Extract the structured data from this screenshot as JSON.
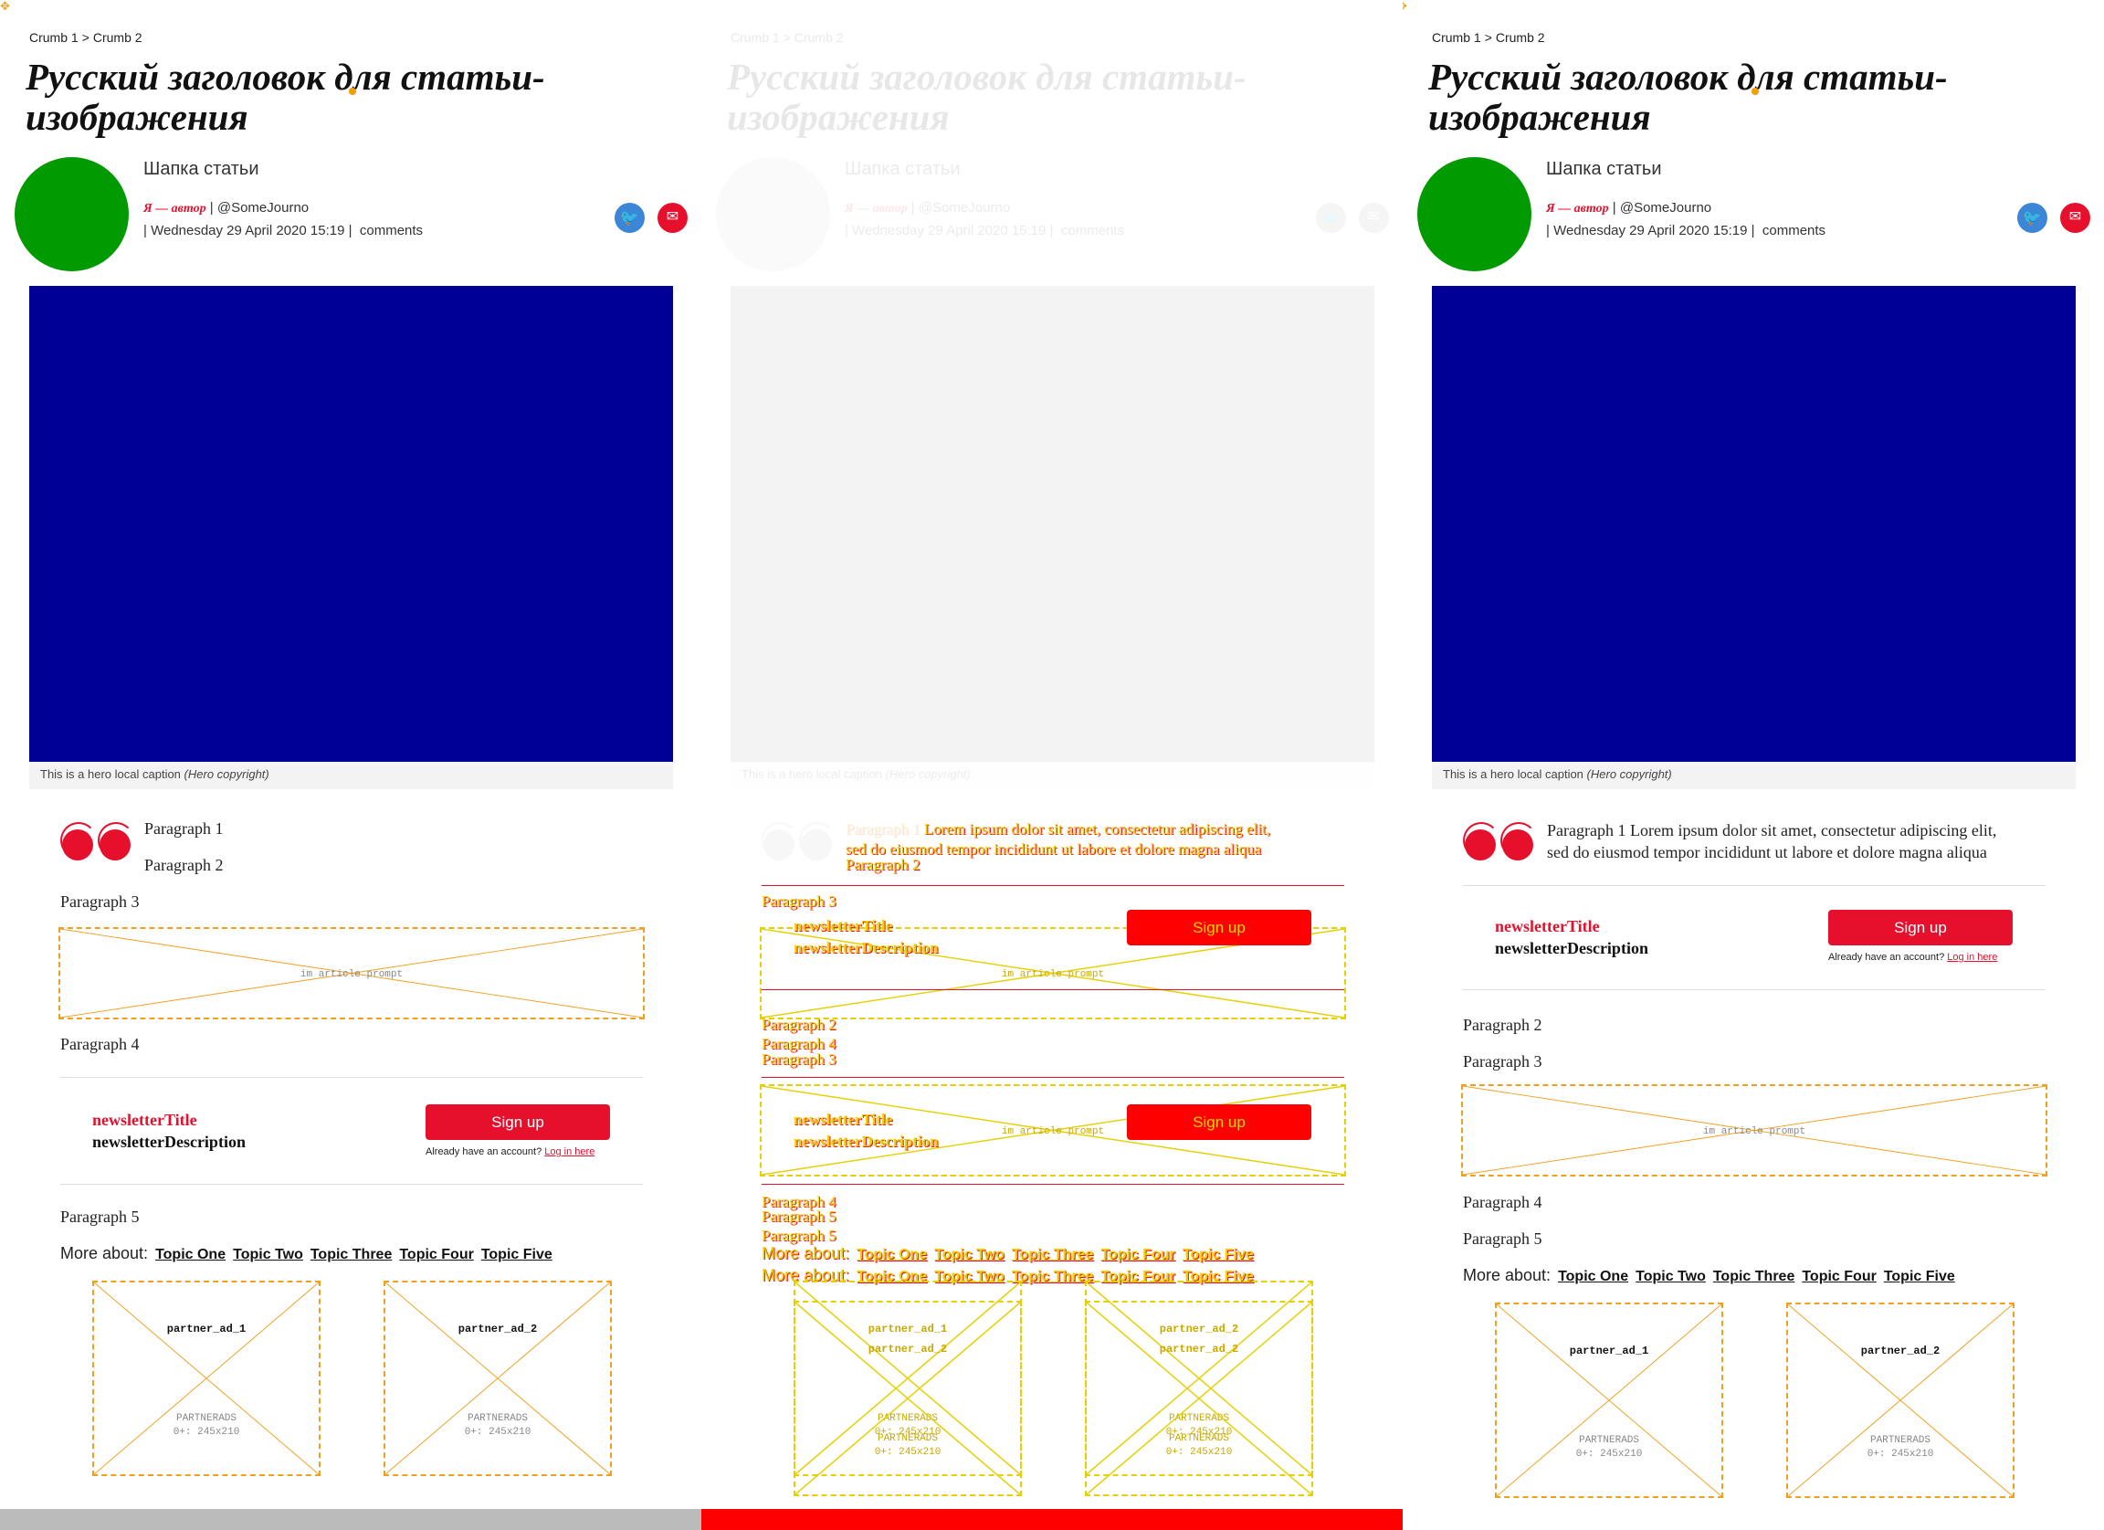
{
  "article": {
    "corner_glyph": "✥",
    "crumbs": [
      "Crumb 1",
      ">",
      "Crumb 2"
    ],
    "title": "Русский заголовок для статьи-изображения",
    "standfirst": "Шапка статьи",
    "author": "Я — автор",
    "separator": "|",
    "handle": "@SomeJourno",
    "date": "| Wednesday 29 April 2020 15:19 |",
    "comments": "comments",
    "twitter_glyph": "🐦",
    "mail_glyph": "✉",
    "caption_text": "This is a hero local caption",
    "caption_copyright": "(Hero copyright)",
    "hero_color": "#000096",
    "accent_color": "#e6102d",
    "avatar_color": "#019a00"
  },
  "paragraphs": {
    "p1": "Paragraph 1",
    "p2": "Paragraph 2",
    "p3": "Paragraph 3",
    "p4": "Paragraph 4",
    "p5": "Paragraph 5",
    "p1_full_lead": "Paragraph 1",
    "p1_full_body_a": "Lorem ipsum dolor sit amet, consectetur adipiscing elit,",
    "p1_full_body_b": "sed do eiusmod tempor incididunt ut labore et dolore magna aliqua"
  },
  "prompt": {
    "label": "im article prompt"
  },
  "newsletter": {
    "title": "newsletterTitle",
    "description": "newsletterDescription",
    "signup": "Sign up",
    "login_prefix": "Already have an account?",
    "login_link": "Log in here"
  },
  "more_about": {
    "label": "More about:",
    "topics": [
      "Topic One",
      "Topic Two",
      "Topic Three",
      "Topic Four",
      "Topic Five"
    ]
  },
  "ads": [
    {
      "name": "partner_ad_1",
      "provider": "PARTNERADS",
      "size": "0+: 245x210"
    },
    {
      "name": "partner_ad_2",
      "provider": "PARTNERADS",
      "size": "0+: 245x210"
    }
  ],
  "bottom_bars": {
    "left_color": "#bbbbbb",
    "middle_color": "#ff0000"
  }
}
